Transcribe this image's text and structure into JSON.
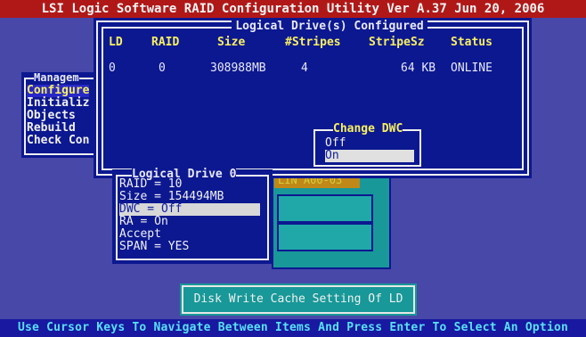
{
  "title_bar": "LSI Logic Software RAID Configuration Utility Ver A.37 Jun 20, 2006",
  "ld_window": {
    "title": "Logical Drive(s) Configured",
    "headers": [
      "LD",
      "RAID",
      "Size",
      "#Stripes",
      "StripeSz",
      "Status"
    ],
    "row": {
      "ld": "0",
      "raid": "0",
      "size": "308988MB",
      "stripes": "4",
      "stripesz": "64  KB",
      "status": "ONLINE"
    }
  },
  "management_menu": {
    "title": "Managem",
    "items": [
      "Configure",
      "Initializ",
      "Objects",
      "Rebuild",
      "Check Con"
    ]
  },
  "change_dwc": {
    "title": "Change DWC",
    "options": [
      "Off",
      "On"
    ],
    "selected": "On"
  },
  "array_panel": {
    "span_label": "LIN A00-03"
  },
  "logical_drive_0": {
    "title": "Logical Drive 0",
    "items": [
      "RAID = 10",
      "Size = 154494MB",
      "DWC  = Off",
      "RA   = On",
      "Accept",
      "SPAN = YES"
    ]
  },
  "hint": "Disk Write Cache Setting Of LD",
  "status_bar": "Use Cursor Keys To Navigate Between Items And Press Enter To Select An Option",
  "colors": {
    "background": "#4848a8",
    "title_bar": "#b01818",
    "window": "#0c1890",
    "panel": "#189898",
    "highlight": "#f8f060"
  }
}
